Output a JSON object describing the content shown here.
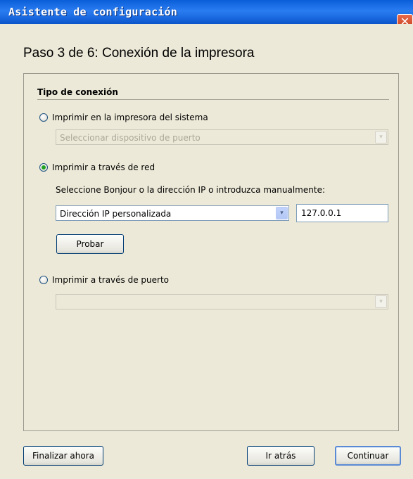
{
  "window": {
    "title": "Asistente de configuración",
    "close_glyph": "✕",
    "close_icon": "close-icon"
  },
  "wizard": {
    "step_title": "Paso 3 de 6: Conexión de la impresora",
    "group_label": "Tipo de conexión",
    "options": {
      "system_printer": {
        "label": "Imprimir en la impresora del sistema",
        "checked": false,
        "port_select_placeholder": "Seleccionar dispositivo de puerto"
      },
      "network": {
        "label": "Imprimir a través de red",
        "checked": true,
        "prompt": "Seleccione Bonjour o la dirección IP o introduzca manualmente:",
        "ip_mode_selected": "Dirección IP personalizada",
        "ip_value": "127.0.0.1",
        "test_button": "Probar"
      },
      "port": {
        "label": "Imprimir a través de puerto",
        "checked": false,
        "port_select_value": ""
      }
    }
  },
  "footer": {
    "finish_now": "Finalizar ahora",
    "back": "Ir atrás",
    "continue": "Continuar"
  },
  "icons": {
    "dropdown_glyph": "▾"
  },
  "colors": {
    "titlebar": "#0a5fd9",
    "close": "#c5401f",
    "background": "#ece9d8",
    "radio_dot": "#21a121"
  }
}
